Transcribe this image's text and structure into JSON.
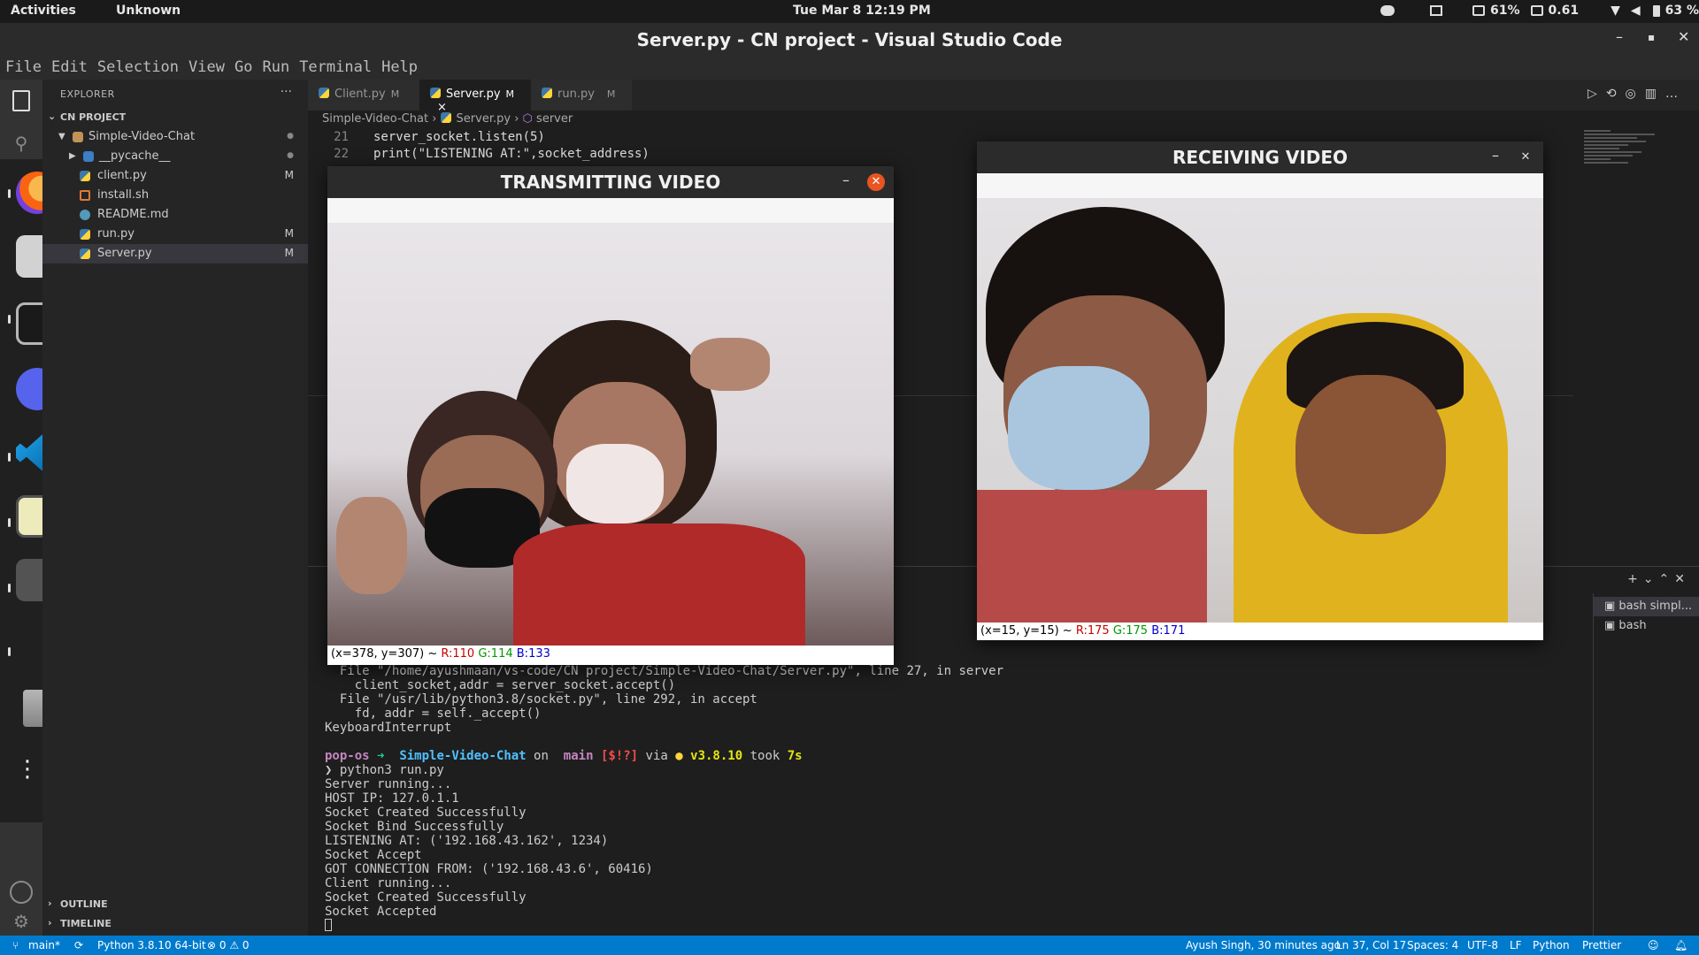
{
  "topbar": {
    "activities": "Activities",
    "app_name": "Unknown",
    "clock": "Tue Mar 8  12:19 PM",
    "battery_meter": "61%",
    "load": "0.61",
    "battery": "63 %"
  },
  "window": {
    "title": "Server.py - CN project - Visual Studio Code",
    "minimize": "–",
    "maximize": "▪",
    "close": "✕"
  },
  "menu": [
    "File",
    "Edit",
    "Selection",
    "View",
    "Go",
    "Run",
    "Terminal",
    "Help"
  ],
  "explorer": {
    "header": "EXPLORER",
    "more": "···",
    "project": "CN PROJECT",
    "items": [
      {
        "label": "Simple-Video-Chat",
        "badge": "●",
        "icon": "folder-icon"
      },
      {
        "label": "__pycache__",
        "badge": "●",
        "icon": "folder-icon"
      },
      {
        "label": "client.py",
        "badge": "M",
        "icon": "python-icon"
      },
      {
        "label": "install.sh",
        "badge": "",
        "icon": "shell-icon"
      },
      {
        "label": "README.md",
        "badge": "",
        "icon": "info-icon"
      },
      {
        "label": "run.py",
        "badge": "M",
        "icon": "python-icon"
      },
      {
        "label": "Server.py",
        "badge": "M",
        "icon": "python-icon"
      }
    ],
    "outline": "OUTLINE",
    "timeline": "TIMELINE"
  },
  "tabs": [
    {
      "label": "Client.py",
      "mod": "M"
    },
    {
      "label": "Server.py",
      "mod": "M"
    },
    {
      "label": "run.py",
      "mod": "M"
    }
  ],
  "breadcrumb": {
    "folder": "Simple-Video-Chat",
    "file": "Server.py",
    "symbol": "server"
  },
  "code": [
    {
      "ln": "21",
      "text": "server_socket.listen(5)"
    },
    {
      "ln": "22",
      "text": "print(\"LISTENING AT:\",socket_address)"
    }
  ],
  "terminal": {
    "lines": [
      "  File \"/home/ayushmaan/vs-code/CN project/Simple-Video-Chat/Server.py\", line 27, in server",
      "    client_socket,addr = server_socket.accept()",
      "  File \"/usr/lib/python3.8/socket.py\", line 292, in accept",
      "    fd, addr = self._accept()",
      "KeyboardInterrupt",
      ""
    ],
    "prompt": {
      "host": "pop-os",
      "arrow": "➜",
      "dir": "Simple-Video-Chat",
      "on": "on",
      "branch": "main",
      "status": "[$!?]",
      "via": "via",
      "version": "v3.8.10",
      "took": "took",
      "time": "7s"
    },
    "command": "❯ python3 run.py",
    "output": [
      "Server running...",
      "HOST IP: 127.0.1.1",
      "Socket Created Successfully",
      "Socket Bind Successfully",
      "LISTENING AT: ('192.168.43.162', 1234)",
      "Socket Accept",
      "GOT CONNECTION FROM: ('192.168.43.6', 60416)",
      "Client running...",
      "Socket Created Successfully",
      "Socket Accepted"
    ],
    "sessions": [
      "bash simpl...",
      "bash"
    ]
  },
  "tx_window": {
    "title": "TRANSMITTING VIDEO",
    "coords": "(x=378, y=307) ~",
    "r": "R:110",
    "g": "G:114",
    "b": "B:133"
  },
  "rx_window": {
    "title": "RECEIVING VIDEO",
    "coords": "(x=15, y=15) ~",
    "r": "R:175",
    "g": "G:175",
    "b": "B:171"
  },
  "statusbar": {
    "branch": "main*",
    "interpreter": "Python 3.8.10 64-bit",
    "problems": "⊗ 0 ⚠ 0",
    "blame": "Ayush Singh, 30 minutes ago",
    "position": "Ln 37, Col 17",
    "spaces": "Spaces: 4",
    "encoding": "UTF-8",
    "eol": "LF",
    "language": "Python",
    "formatter": "Prettier"
  },
  "colors": {
    "status_bar": "#007acc",
    "editor_bg": "#1e1e1e",
    "sidebar_bg": "#252526"
  }
}
